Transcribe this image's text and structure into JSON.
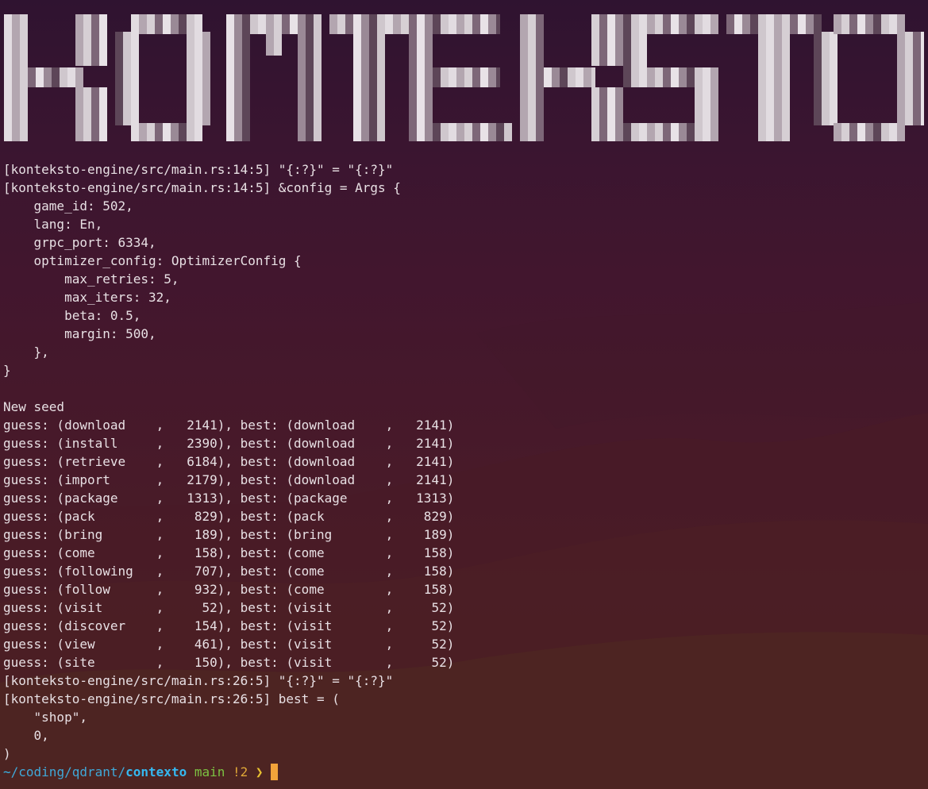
{
  "banner": {
    "text": "KONTEKSTO"
  },
  "terminal": {
    "lines": [
      "[konteksto-engine/src/main.rs:14:5] \"{:?}\" = \"{:?}\"",
      "[konteksto-engine/src/main.rs:14:5] &config = Args {",
      "    game_id: 502,",
      "    lang: En,",
      "    grpc_port: 6334,",
      "    optimizer_config: OptimizerConfig {",
      "        max_retries: 5,",
      "        max_iters: 32,",
      "        beta: 0.5,",
      "        margin: 500,",
      "    },",
      "}",
      "",
      "New seed",
      "guess: (download    ,   2141), best: (download    ,   2141)",
      "guess: (install     ,   2390), best: (download    ,   2141)",
      "guess: (retrieve    ,   6184), best: (download    ,   2141)",
      "guess: (import      ,   2179), best: (download    ,   2141)",
      "guess: (package     ,   1313), best: (package     ,   1313)",
      "guess: (pack        ,    829), best: (pack        ,    829)",
      "guess: (bring       ,    189), best: (bring       ,    189)",
      "guess: (come        ,    158), best: (come        ,    158)",
      "guess: (following   ,    707), best: (come        ,    158)",
      "guess: (follow      ,    932), best: (come        ,    158)",
      "guess: (visit       ,     52), best: (visit       ,     52)",
      "guess: (discover    ,    154), best: (visit       ,     52)",
      "guess: (view        ,    461), best: (visit       ,     52)",
      "guess: (site        ,    150), best: (visit       ,     52)",
      "[konteksto-engine/src/main.rs:26:5] \"{:?}\" = \"{:?}\"",
      "[konteksto-engine/src/main.rs:26:5] best = (",
      "    \"shop\",",
      "    0,",
      ")"
    ],
    "prompt": {
      "tilde": "~",
      "path": "/coding/qdrant/",
      "dir": "contexto",
      "branch": "main",
      "status": "!2",
      "arrow": "❯"
    }
  },
  "colors": {
    "path": "#3fa8d8",
    "branch": "#7cc242",
    "status": "#e0a838",
    "cursor": "#f2a33a"
  }
}
